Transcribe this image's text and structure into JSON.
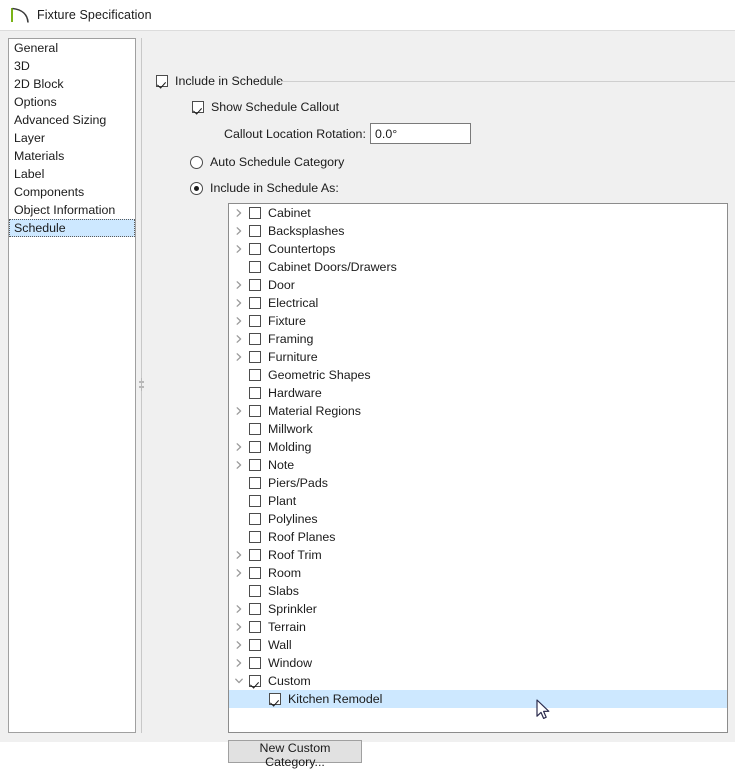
{
  "window": {
    "title": "Fixture Specification",
    "icon": "fixture-arc-icon"
  },
  "sidebar": {
    "items": [
      {
        "label": "General",
        "selected": false
      },
      {
        "label": "3D",
        "selected": false
      },
      {
        "label": "2D Block",
        "selected": false
      },
      {
        "label": "Options",
        "selected": false
      },
      {
        "label": "Advanced Sizing",
        "selected": false
      },
      {
        "label": "Layer",
        "selected": false
      },
      {
        "label": "Materials",
        "selected": false
      },
      {
        "label": "Label",
        "selected": false
      },
      {
        "label": "Components",
        "selected": false
      },
      {
        "label": "Object Information",
        "selected": false
      },
      {
        "label": "Schedule",
        "selected": true
      }
    ]
  },
  "panel": {
    "include_in_schedule": {
      "label": "Include in Schedule",
      "checked": true
    },
    "show_schedule_callout": {
      "label": "Show Schedule Callout",
      "checked": true
    },
    "callout_rotation": {
      "label": "Callout Location Rotation:",
      "value": "0.0°",
      "placeholder": "0.0°"
    },
    "mode": {
      "auto": {
        "label": "Auto Schedule Category",
        "selected": false
      },
      "as": {
        "label": "Include in Schedule As:",
        "selected": true
      }
    },
    "new_custom_category_button": "New Custom Category...",
    "tree": [
      {
        "label": "Cabinet",
        "expander": "collapsed",
        "checked": false,
        "indent": 0,
        "selected": false
      },
      {
        "label": "Backsplashes",
        "expander": "collapsed",
        "checked": false,
        "indent": 0,
        "selected": false
      },
      {
        "label": "Countertops",
        "expander": "collapsed",
        "checked": false,
        "indent": 0,
        "selected": false
      },
      {
        "label": "Cabinet Doors/Drawers",
        "expander": "none",
        "checked": false,
        "indent": 0,
        "selected": false
      },
      {
        "label": "Door",
        "expander": "collapsed",
        "checked": false,
        "indent": 0,
        "selected": false
      },
      {
        "label": "Electrical",
        "expander": "collapsed",
        "checked": false,
        "indent": 0,
        "selected": false
      },
      {
        "label": "Fixture",
        "expander": "collapsed",
        "checked": false,
        "indent": 0,
        "selected": false
      },
      {
        "label": "Framing",
        "expander": "collapsed",
        "checked": false,
        "indent": 0,
        "selected": false
      },
      {
        "label": "Furniture",
        "expander": "collapsed",
        "checked": false,
        "indent": 0,
        "selected": false
      },
      {
        "label": "Geometric Shapes",
        "expander": "none",
        "checked": false,
        "indent": 0,
        "selected": false
      },
      {
        "label": "Hardware",
        "expander": "none",
        "checked": false,
        "indent": 0,
        "selected": false
      },
      {
        "label": "Material Regions",
        "expander": "collapsed",
        "checked": false,
        "indent": 0,
        "selected": false
      },
      {
        "label": "Millwork",
        "expander": "none",
        "checked": false,
        "indent": 0,
        "selected": false
      },
      {
        "label": "Molding",
        "expander": "collapsed",
        "checked": false,
        "indent": 0,
        "selected": false
      },
      {
        "label": "Note",
        "expander": "collapsed",
        "checked": false,
        "indent": 0,
        "selected": false
      },
      {
        "label": "Piers/Pads",
        "expander": "none",
        "checked": false,
        "indent": 0,
        "selected": false
      },
      {
        "label": "Plant",
        "expander": "none",
        "checked": false,
        "indent": 0,
        "selected": false
      },
      {
        "label": "Polylines",
        "expander": "none",
        "checked": false,
        "indent": 0,
        "selected": false
      },
      {
        "label": "Roof Planes",
        "expander": "none",
        "checked": false,
        "indent": 0,
        "selected": false
      },
      {
        "label": "Roof Trim",
        "expander": "collapsed",
        "checked": false,
        "indent": 0,
        "selected": false
      },
      {
        "label": "Room",
        "expander": "collapsed",
        "checked": false,
        "indent": 0,
        "selected": false
      },
      {
        "label": "Slabs",
        "expander": "none",
        "checked": false,
        "indent": 0,
        "selected": false
      },
      {
        "label": "Sprinkler",
        "expander": "collapsed",
        "checked": false,
        "indent": 0,
        "selected": false
      },
      {
        "label": "Terrain",
        "expander": "collapsed",
        "checked": false,
        "indent": 0,
        "selected": false
      },
      {
        "label": "Wall",
        "expander": "collapsed",
        "checked": false,
        "indent": 0,
        "selected": false
      },
      {
        "label": "Window",
        "expander": "collapsed",
        "checked": false,
        "indent": 0,
        "selected": false
      },
      {
        "label": "Custom",
        "expander": "expanded",
        "checked": true,
        "indent": 0,
        "selected": false
      },
      {
        "label": "Kitchen Remodel",
        "expander": "none",
        "checked": true,
        "indent": 1,
        "selected": true
      }
    ]
  },
  "colors": {
    "selection": "#cde8ff",
    "window_bg": "#f0f0f0",
    "field_bg": "#ffffff",
    "border": "#8c8c8c",
    "icon_accent": "#7ab317"
  }
}
